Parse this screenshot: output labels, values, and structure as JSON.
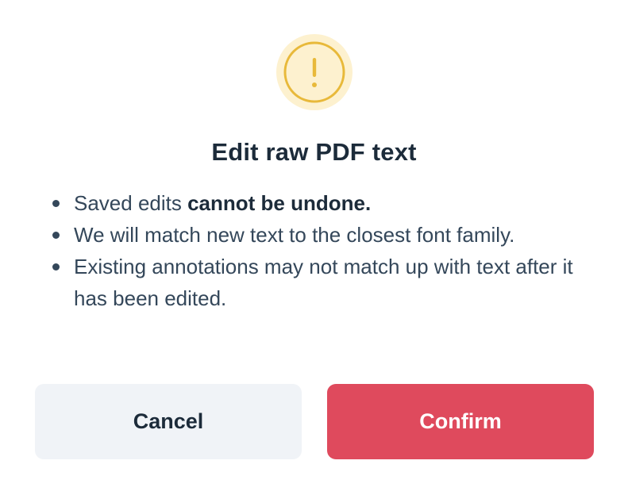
{
  "dialog": {
    "icon": "warning-exclamation-icon",
    "title": "Edit raw PDF text",
    "bullets": [
      {
        "prefix": "Saved edits ",
        "emphasis": "cannot be undone.",
        "suffix": ""
      },
      {
        "prefix": "We will match new text to the closest font family.",
        "emphasis": "",
        "suffix": ""
      },
      {
        "prefix": "Existing annotations may not match up with text after it has been edited.",
        "emphasis": "",
        "suffix": ""
      }
    ],
    "cancel_label": "Cancel",
    "confirm_label": "Confirm"
  },
  "colors": {
    "warning_bg": "#fdf1cf",
    "warning_fg": "#e8b93a",
    "confirm_bg": "#df4a5d",
    "cancel_bg": "#f0f3f7",
    "text_dark": "#1c2b3a"
  }
}
